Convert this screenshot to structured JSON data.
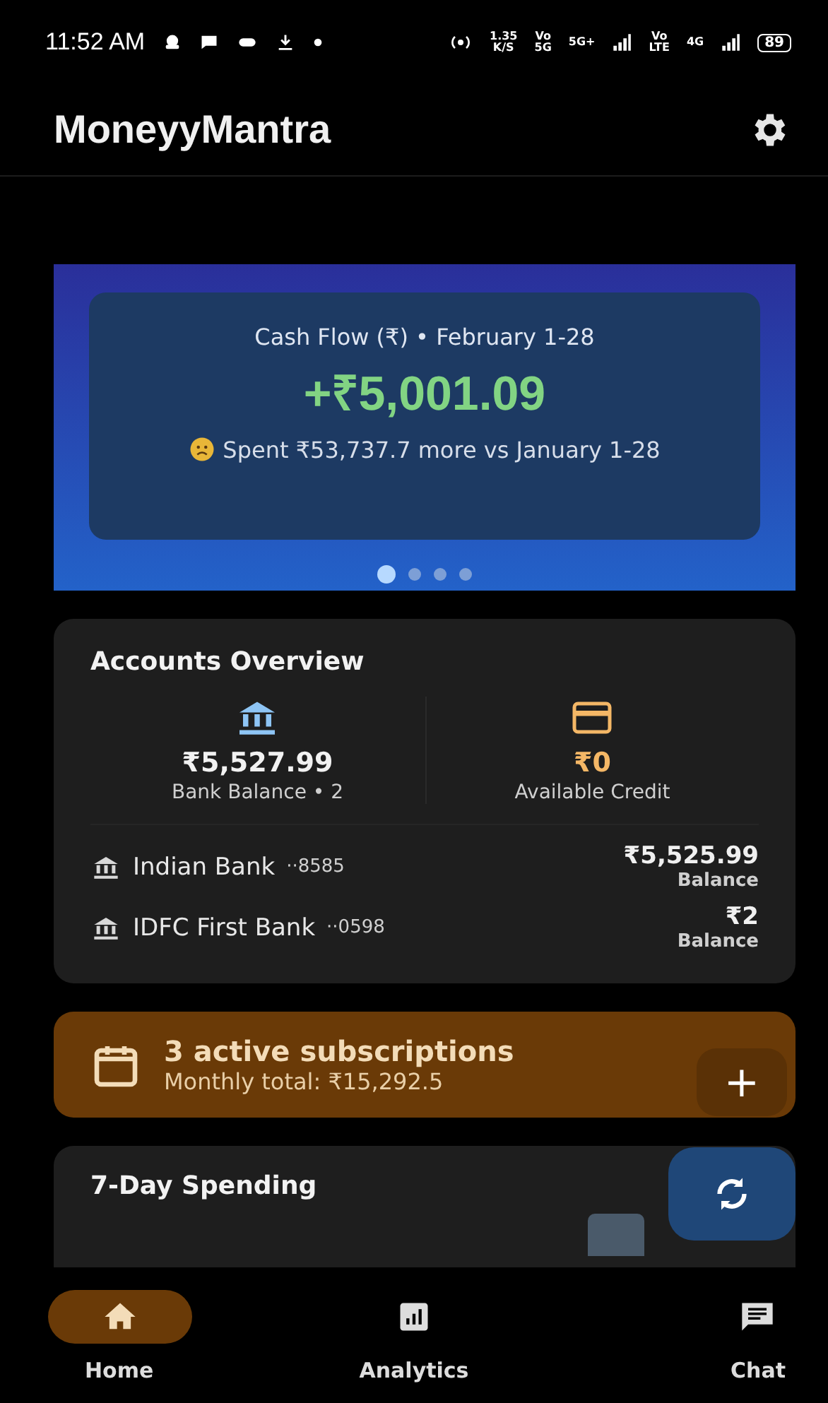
{
  "status_bar": {
    "time": "11:52 AM",
    "speed": [
      "1.35",
      "K/S"
    ],
    "network_labels": [
      [
        "Vo",
        "5G"
      ],
      [
        "5G+"
      ],
      [
        "Vo",
        "LTE"
      ],
      [
        "4G"
      ]
    ],
    "battery": "89"
  },
  "app_bar": {
    "title": "MoneyyMantra"
  },
  "cash_flow": {
    "title": "Cash Flow (₹) • February 1-28",
    "amount": "+₹5,001.09",
    "note": "Spent ₹53,737.7 more vs January 1-28",
    "pages": [
      {
        "selected": true
      },
      {
        "selected": false
      },
      {
        "selected": false
      },
      {
        "selected": false
      }
    ]
  },
  "accounts_overview": {
    "title": "Accounts Overview",
    "summaries": [
      {
        "kind": "bank",
        "amount": "₹5,527.99",
        "label": "Bank Balance • 2"
      },
      {
        "kind": "credit",
        "amount": "₹0",
        "label": "Available Credit"
      }
    ],
    "accounts": [
      {
        "name": "Indian Bank",
        "number": "··8585",
        "amount": "₹5,525.99",
        "label": "Balance"
      },
      {
        "name": "IDFC First Bank",
        "number": "··0598",
        "amount": "₹2",
        "label": "Balance"
      }
    ]
  },
  "subscriptions": {
    "title": "3 active subscriptions",
    "subtitle": "Monthly total: ₹15,292.5"
  },
  "spending": {
    "title": "7-Day Spending"
  },
  "fabs": [
    {
      "kind": "add",
      "label": "+"
    },
    {
      "kind": "sync"
    }
  ],
  "bottom_nav": [
    {
      "kind": "home",
      "label": "Home",
      "selected": true
    },
    {
      "kind": "analytics",
      "label": "Analytics",
      "selected": false
    },
    {
      "kind": "chat",
      "label": "Chat",
      "selected": false
    }
  ]
}
